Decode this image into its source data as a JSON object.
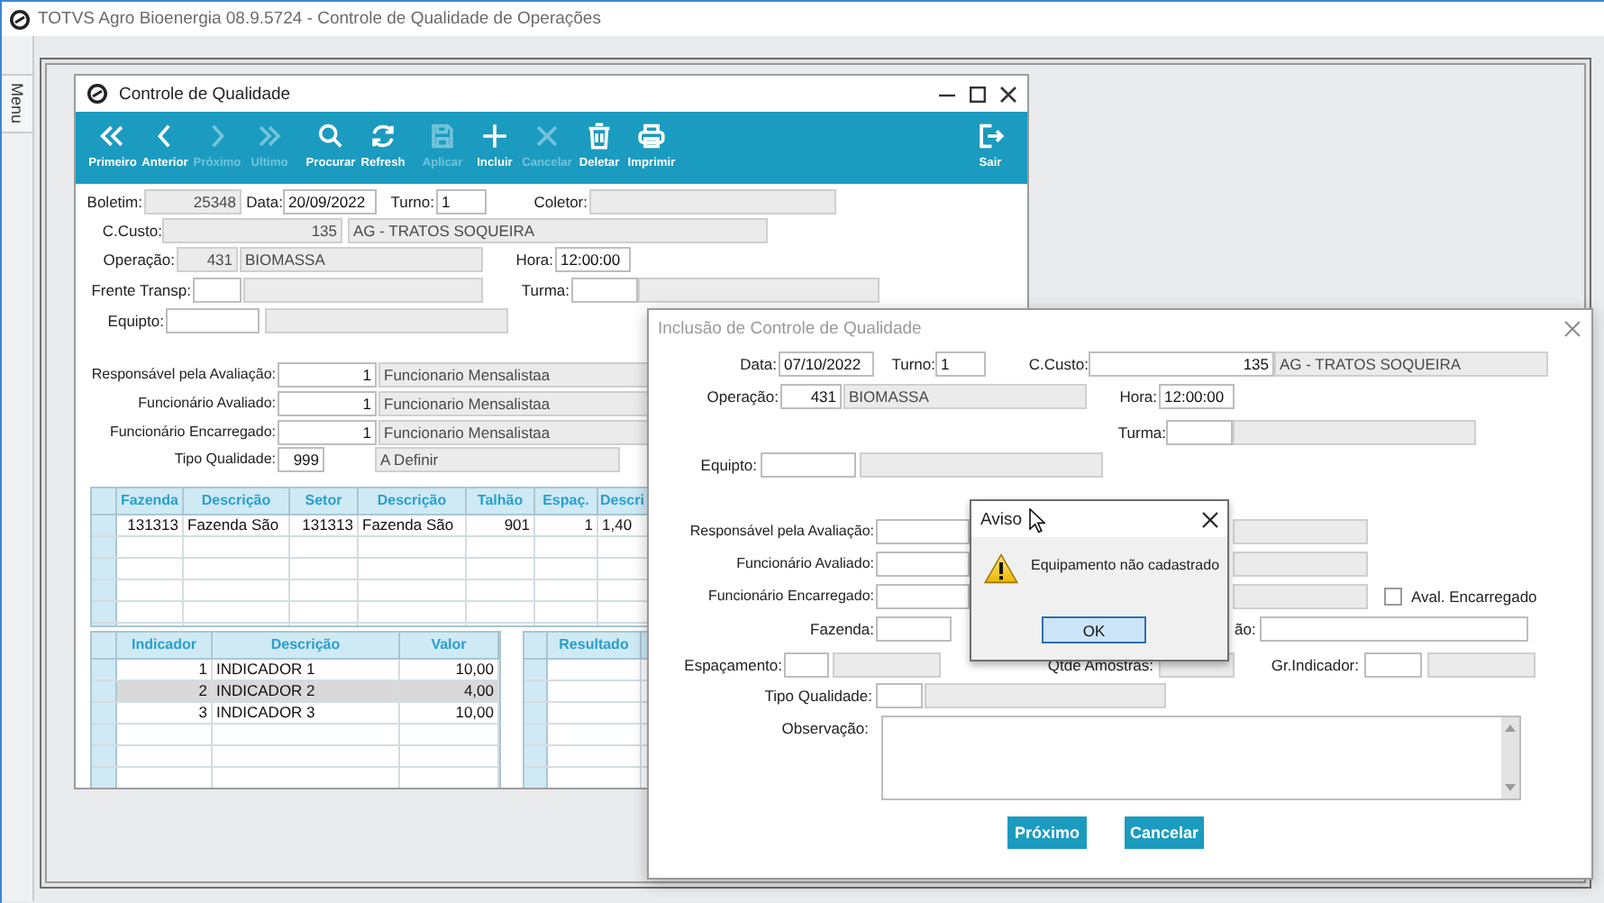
{
  "app": {
    "title": "TOTVS Agro Bioenergia 08.9.5724 - Controle de Qualidade de Operações",
    "side_tab": "Menu"
  },
  "main_window": {
    "title": "Controle de Qualidade",
    "toolbar": [
      {
        "label": "Primeiro",
        "disabled": false
      },
      {
        "label": "Anterior",
        "disabled": false
      },
      {
        "label": "Próximo",
        "disabled": true
      },
      {
        "label": "Ultimo",
        "disabled": true
      },
      {
        "label": "Procurar",
        "disabled": false
      },
      {
        "label": "Refresh",
        "disabled": false
      },
      {
        "label": "Aplicar",
        "disabled": true
      },
      {
        "label": "Incluir",
        "disabled": false
      },
      {
        "label": "Cancelar",
        "disabled": true
      },
      {
        "label": "Deletar",
        "disabled": false
      },
      {
        "label": "Imprimir",
        "disabled": false
      }
    ],
    "exit_button": {
      "label": "Sair",
      "disabled": false
    },
    "form": [
      {
        "items": [
          {
            "kind": "label",
            "text": "Boletim:"
          },
          {
            "kind": "field",
            "value": "25348",
            "readonly": true
          },
          {
            "kind": "label",
            "text": "Data:"
          },
          {
            "kind": "field",
            "value": "20/09/2022",
            "readonly": false
          },
          {
            "kind": "label",
            "text": "Turno:"
          },
          {
            "kind": "field",
            "value": "1",
            "readonly": false
          },
          {
            "kind": "label",
            "text": "Coletor:"
          },
          {
            "kind": "field",
            "readonly": true
          }
        ]
      },
      {
        "items": [
          {
            "kind": "label",
            "text": "C.Custo:"
          },
          {
            "kind": "field",
            "value": "135",
            "readonly": true
          },
          {
            "kind": "field",
            "value": "AG - TRATOS SOQUEIRA",
            "readonly": true
          }
        ]
      },
      {
        "items": [
          {
            "kind": "label",
            "text": "Operação:"
          },
          {
            "kind": "field",
            "value": "431",
            "readonly": true
          },
          {
            "kind": "field",
            "value": "BIOMASSA",
            "readonly": true
          },
          {
            "kind": "label",
            "text": "Hora:"
          },
          {
            "kind": "field",
            "value": "12:00:00",
            "readonly": false
          }
        ]
      },
      {
        "items": [
          {
            "kind": "label",
            "text": "Frente Transp:"
          },
          {
            "kind": "field",
            "readonly": false
          },
          {
            "kind": "field",
            "readonly": true
          },
          {
            "kind": "label",
            "text": "Turma:"
          },
          {
            "kind": "field",
            "readonly": false
          },
          {
            "kind": "field",
            "readonly": true
          }
        ]
      },
      {
        "items": [
          {
            "kind": "label",
            "text": "Equipto:"
          },
          {
            "kind": "field",
            "readonly": false
          },
          {
            "kind": "field",
            "readonly": true
          }
        ]
      },
      {
        "items": [
          {
            "kind": "label",
            "text": "Responsável pela Avaliação:"
          },
          {
            "kind": "field",
            "value": "1",
            "readonly": false
          },
          {
            "kind": "field",
            "value": "Funcionario Mensalistaa",
            "readonly": true
          }
        ]
      },
      {
        "items": [
          {
            "kind": "label",
            "text": "Funcionário Avaliado:"
          },
          {
            "kind": "field",
            "value": "1",
            "readonly": false
          },
          {
            "kind": "field",
            "value": "Funcionario Mensalistaa",
            "readonly": true
          }
        ]
      },
      {
        "items": [
          {
            "kind": "label",
            "text": "Funcionário Encarregado:"
          },
          {
            "kind": "field",
            "value": "1",
            "readonly": false
          },
          {
            "kind": "field",
            "value": "Funcionario Mensalistaa",
            "readonly": true
          }
        ]
      },
      {
        "items": [
          {
            "kind": "label",
            "text": "Tipo Qualidade:"
          },
          {
            "kind": "field",
            "value": "999",
            "readonly": false
          },
          {
            "kind": "field",
            "value": "A Definir",
            "readonly": true
          }
        ]
      }
    ],
    "location_grid": {
      "columns": [
        "Fazenda",
        "Descrição",
        "Setor",
        "Descrição",
        "Talhão",
        "Espaç.",
        "Descri"
      ],
      "rows": [
        {
          "cells": [
            "131313",
            "Fazenda São",
            "131313",
            "Fazenda São",
            "901",
            "1",
            "1,40"
          ],
          "selected": false
        }
      ]
    },
    "indicator_grid": {
      "columns": [
        "Indicador",
        "Descrição",
        "Valor"
      ],
      "rows": [
        {
          "cells": [
            "1",
            "INDICADOR 1",
            "10,00"
          ],
          "selected": false
        },
        {
          "cells": [
            "2",
            "INDICADOR 2",
            "4,00"
          ],
          "selected": true
        },
        {
          "cells": [
            "3",
            "INDICADOR 3",
            "10,00"
          ],
          "selected": false
        }
      ]
    },
    "result_grid": {
      "columns": [
        "Resultado"
      ]
    }
  },
  "dialog": {
    "title": "Inclusão de Controle de Qualidade",
    "active": false,
    "form": [
      {
        "items": [
          {
            "kind": "label",
            "text": "Data:"
          },
          {
            "kind": "field",
            "value": "07/10/2022",
            "readonly": false
          },
          {
            "kind": "label",
            "text": "Turno:"
          },
          {
            "kind": "field",
            "value": "1",
            "readonly": false
          },
          {
            "kind": "label",
            "text": "C.Custo:"
          },
          {
            "kind": "field",
            "value": "135",
            "readonly": false
          },
          {
            "kind": "field",
            "value": "AG - TRATOS SOQUEIRA",
            "readonly": true
          }
        ]
      },
      {
        "items": [
          {
            "kind": "label",
            "text": "Operação:"
          },
          {
            "kind": "field",
            "value": "431",
            "readonly": false
          },
          {
            "kind": "field",
            "value": "BIOMASSA",
            "readonly": true
          },
          {
            "kind": "label",
            "text": "Hora:"
          },
          {
            "kind": "field",
            "value": "12:00:00",
            "readonly": false
          }
        ]
      },
      {
        "items": [
          {
            "kind": "label",
            "text": "Turma:"
          },
          {
            "kind": "field",
            "readonly": false
          },
          {
            "kind": "field",
            "readonly": true
          }
        ]
      },
      {
        "items": [
          {
            "kind": "label",
            "text": "Equipto:"
          },
          {
            "kind": "field",
            "readonly": false
          },
          {
            "kind": "field",
            "readonly": true
          }
        ]
      },
      {
        "items": [
          {
            "kind": "label",
            "text": "Responsável pela Avaliação:"
          },
          {
            "kind": "field",
            "readonly": false
          },
          {
            "kind": "field",
            "readonly": true
          }
        ]
      },
      {
        "items": [
          {
            "kind": "label",
            "text": "Funcionário Avaliado:"
          },
          {
            "kind": "field",
            "readonly": false
          },
          {
            "kind": "field",
            "readonly": true
          }
        ]
      },
      {
        "items": [
          {
            "kind": "label",
            "text": "Funcionário Encarregado:"
          },
          {
            "kind": "field",
            "readonly": false
          },
          {
            "kind": "field",
            "readonly": true
          },
          {
            "kind": "checkbox",
            "label": "Aval. Encarregado",
            "checked": false
          }
        ]
      },
      {
        "items": [
          {
            "kind": "label",
            "text": "Fazenda:"
          },
          {
            "kind": "field",
            "readonly": false
          },
          {
            "kind": "label",
            "text": "ão:"
          },
          {
            "kind": "field",
            "readonly": false
          }
        ]
      },
      {
        "items": [
          {
            "kind": "label",
            "text": "Espaçamento:"
          },
          {
            "kind": "field",
            "readonly": false
          },
          {
            "kind": "field",
            "readonly": true
          },
          {
            "kind": "label",
            "text": "Qtde Amostras:"
          },
          {
            "kind": "field",
            "readonly": true
          },
          {
            "kind": "label",
            "text": "Gr.Indicador:"
          },
          {
            "kind": "field",
            "readonly": false
          },
          {
            "kind": "field",
            "readonly": true
          }
        ]
      },
      {
        "items": [
          {
            "kind": "label",
            "text": "Tipo Qualidade:"
          },
          {
            "kind": "field",
            "readonly": false
          },
          {
            "kind": "field",
            "readonly": true
          }
        ]
      },
      {
        "items": [
          {
            "kind": "label",
            "text": "Observação:"
          },
          {
            "kind": "memo"
          }
        ]
      }
    ],
    "buttons": [
      {
        "label": "Próximo"
      },
      {
        "label": "Cancelar"
      }
    ]
  },
  "alert": {
    "title": "Aviso",
    "message": "Equipamento não cadastrado",
    "button": "OK"
  }
}
